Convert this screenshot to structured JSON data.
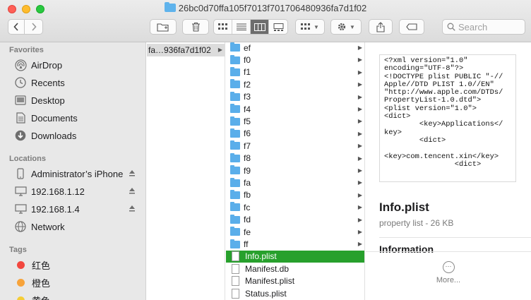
{
  "window": {
    "title": "26bc0d70ffa105f7013f701706480936fa7d1f02"
  },
  "toolbar": {
    "back_label": "‹",
    "forward_label": "›",
    "search_placeholder": "Search"
  },
  "sidebar": {
    "favorites_title": "Favorites",
    "favorites": [
      {
        "label": "AirDrop",
        "icon": "airdrop-icon"
      },
      {
        "label": "Recents",
        "icon": "clock-icon"
      },
      {
        "label": "Desktop",
        "icon": "desktop-icon"
      },
      {
        "label": "Documents",
        "icon": "document-icon"
      },
      {
        "label": "Downloads",
        "icon": "download-icon"
      }
    ],
    "locations_title": "Locations",
    "locations": [
      {
        "label": "Administrator’s iPhone",
        "icon": "iphone-icon"
      },
      {
        "label": "192.168.1.12",
        "icon": "monitor-icon"
      },
      {
        "label": "192.168.1.4",
        "icon": "monitor-icon"
      },
      {
        "label": "Network",
        "icon": "globe-icon"
      }
    ],
    "tags_title": "Tags",
    "tags": [
      {
        "label": "红色",
        "color": "#f2473f"
      },
      {
        "label": "橙色",
        "color": "#f7a33a"
      },
      {
        "label": "黄色",
        "color": "#f5cd36"
      }
    ]
  },
  "column1": {
    "selected": "fa…936fa7d1f02"
  },
  "column2": {
    "folders": [
      "ef",
      "f0",
      "f1",
      "f2",
      "f3",
      "f4",
      "f5",
      "f6",
      "f7",
      "f8",
      "f9",
      "fa",
      "fb",
      "fc",
      "fd",
      "fe",
      "ff"
    ],
    "files": [
      "Info.plist",
      "Manifest.db",
      "Manifest.plist",
      "Status.plist"
    ],
    "selected_file": "Info.plist"
  },
  "preview": {
    "code_lines": [
      "<?xml version=\"1.0\"",
      "encoding=\"UTF-8\"?>",
      "<!DOCTYPE plist PUBLIC \"-//",
      "Apple//DTD PLIST 1.0//EN\"",
      "\"http://www.apple.com/DTDs/",
      "PropertyList-1.0.dtd\">",
      "<plist version=\"1.0\">",
      "<dict>",
      "        <key>Applications</",
      "key>",
      "        <dict>",
      "",
      "<key>com.tencent.xin</key>",
      "                <dict>"
    ],
    "name": "Info.plist",
    "kind": "property list - 26 KB",
    "info_heading": "Information",
    "more_label": "More..."
  },
  "colors": {
    "selection": "#27a02c",
    "folder": "#5aaeea"
  }
}
